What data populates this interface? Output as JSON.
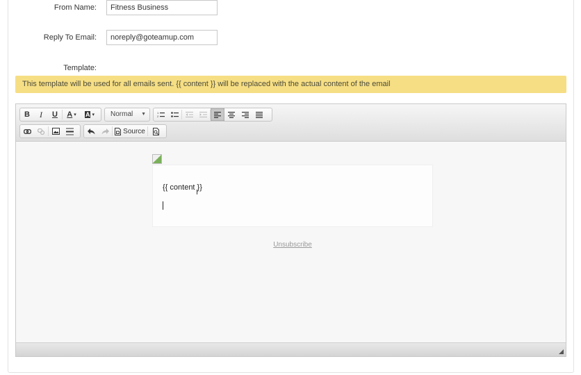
{
  "form": {
    "from_name": {
      "label": "From Name:",
      "value": "Fitness Business"
    },
    "reply_to": {
      "label": "Reply To Email:",
      "value": "noreply@goteamup.com"
    },
    "template": {
      "label": "Template:"
    }
  },
  "notice": {
    "text": "This template will be used for all emails sent. {{ content }} will be replaced with the actual content of the email",
    "color": "#f6de84"
  },
  "toolbar": {
    "row1": {
      "bold": "B",
      "italic": "I",
      "underline": "U",
      "text_color": "A",
      "bg_color": "A",
      "format_select": "Normal"
    },
    "row2": {
      "source_label": "Source"
    }
  },
  "editor": {
    "content_placeholder": "{{ content }}",
    "unsubscribe_link": "Unsubscribe"
  }
}
